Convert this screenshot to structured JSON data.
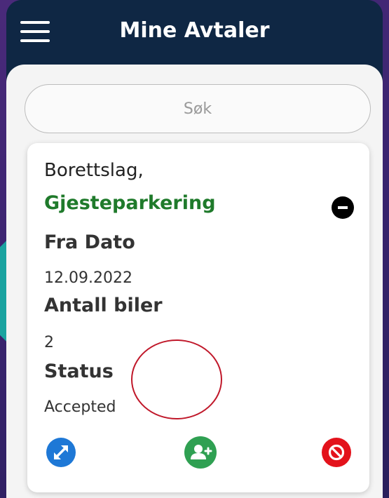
{
  "header": {
    "title": "Mine Avtaler",
    "menu_icon": "hamburger-menu-icon"
  },
  "search": {
    "placeholder": "Søk"
  },
  "agreement": {
    "organization": "Borettslag,",
    "type": "Gjesteparkering",
    "fields": {
      "from_date_label": "Fra Dato",
      "from_date_value": "12.09.2022",
      "cars_label": "Antall biler",
      "cars_value": "2",
      "status_label": "Status",
      "status_value": "Accepted"
    },
    "actions": {
      "collapse_icon": "minus-circle-icon",
      "expand_icon": "expand-arrows-icon",
      "add_user_icon": "add-user-icon",
      "cancel_icon": "block-icon"
    }
  },
  "colors": {
    "header_bg": "#0f2744",
    "type_text": "#1f7a2b",
    "expand_button": "#1e78d6",
    "add_user_button": "#2fa052",
    "cancel_button": "#e3121b",
    "highlight_ring": "#c0182a"
  }
}
